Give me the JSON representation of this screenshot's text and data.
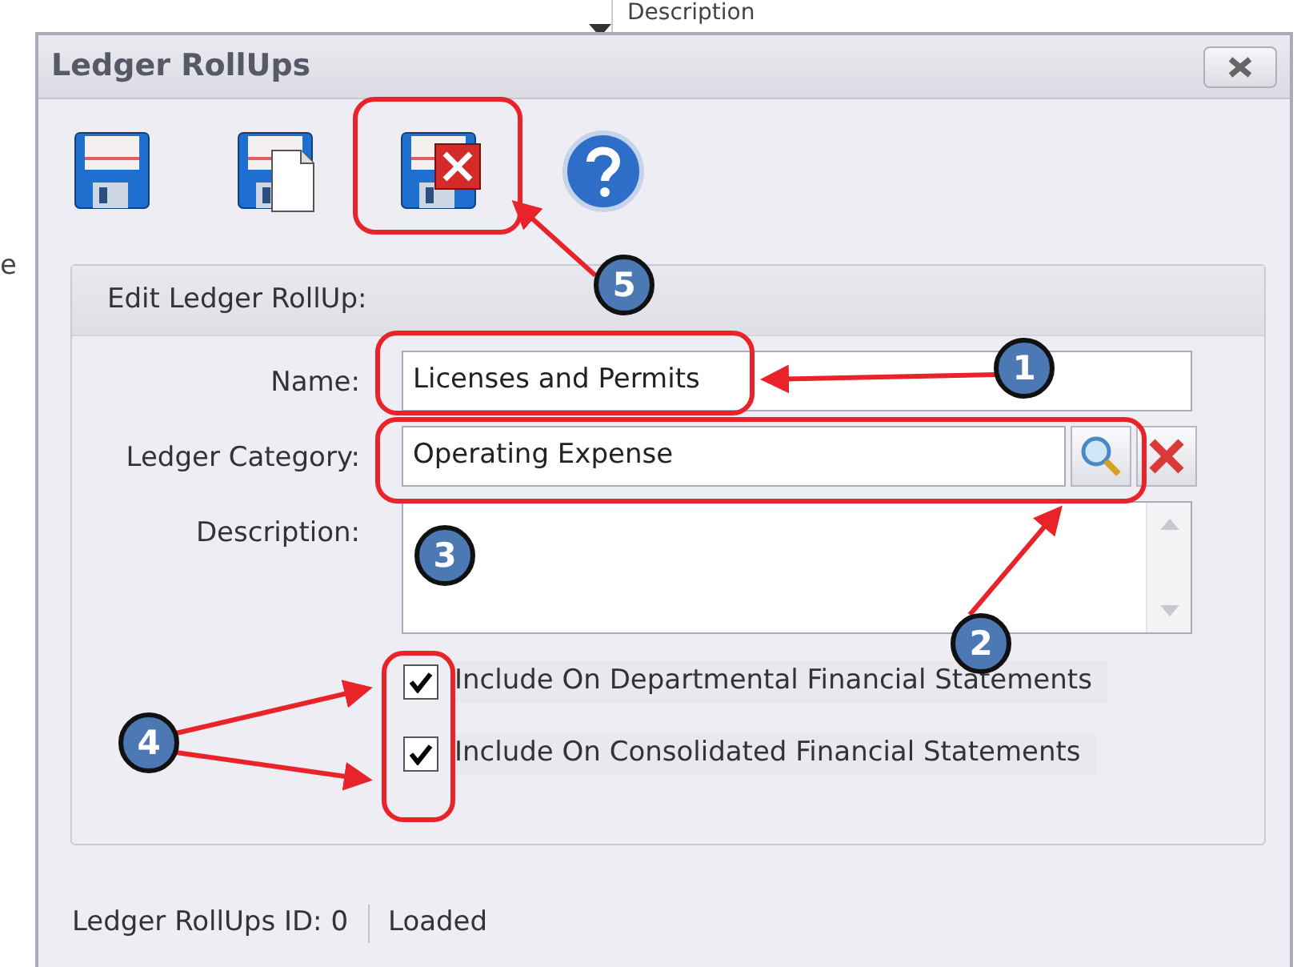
{
  "background": {
    "column_header": "Description",
    "cell_fragment": "e"
  },
  "window": {
    "title": "Ledger RollUps"
  },
  "toolbar": [
    {
      "kind": "save"
    },
    {
      "kind": "save_new"
    },
    {
      "kind": "delete"
    },
    {
      "kind": "help"
    }
  ],
  "group": {
    "title": "Edit Ledger RollUp:",
    "fields": [
      {
        "kind": "text",
        "label": "Name:",
        "value": "Licenses and Permits"
      },
      {
        "kind": "lookup",
        "label": "Ledger Category:",
        "value": "Operating Expense"
      },
      {
        "kind": "memo",
        "label": "Description:"
      }
    ],
    "checkboxes": [
      {
        "label": "Include On Departmental Financial Statements",
        "checked": true
      },
      {
        "label": "Include On Consolidated Financial Statements",
        "checked": true
      }
    ]
  },
  "status_bar": [
    "Ledger RollUps ID: 0",
    "Loaded"
  ],
  "annotations": [
    {
      "number": "1"
    },
    {
      "number": "2"
    },
    {
      "number": "3"
    },
    {
      "number": "4"
    },
    {
      "number": "5"
    }
  ]
}
